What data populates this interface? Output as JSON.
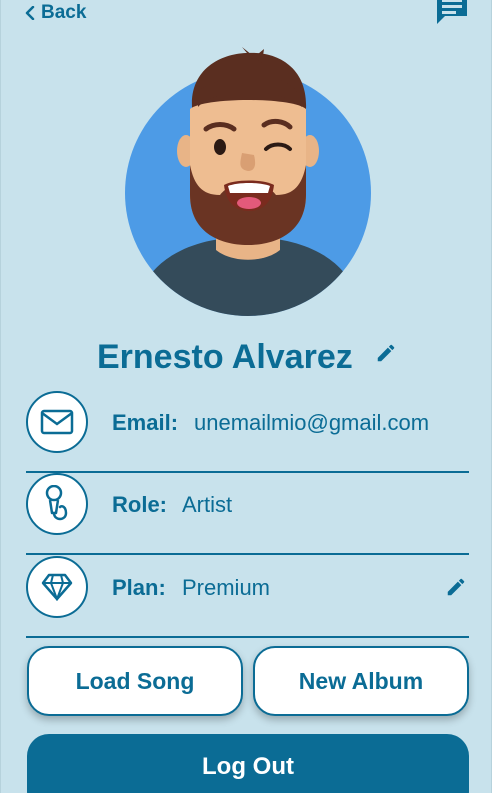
{
  "nav": {
    "back_label": "Back"
  },
  "profile": {
    "name": "Ernesto Alvarez",
    "fields": [
      {
        "label": "Email:",
        "value": "unemailmio@gmail.com",
        "icon": "mail-icon"
      },
      {
        "label": "Role:",
        "value": "Artist",
        "icon": "microphone-icon"
      },
      {
        "label": "Plan:",
        "value": "Premium",
        "icon": "diamond-icon"
      }
    ]
  },
  "actions": {
    "load_song": "Load Song",
    "new_album": "New Album",
    "log_out": "Log Out"
  },
  "colors": {
    "background": "#c8e2ec",
    "primary": "#0b6c95",
    "avatar_bg": "#4d9be6"
  }
}
